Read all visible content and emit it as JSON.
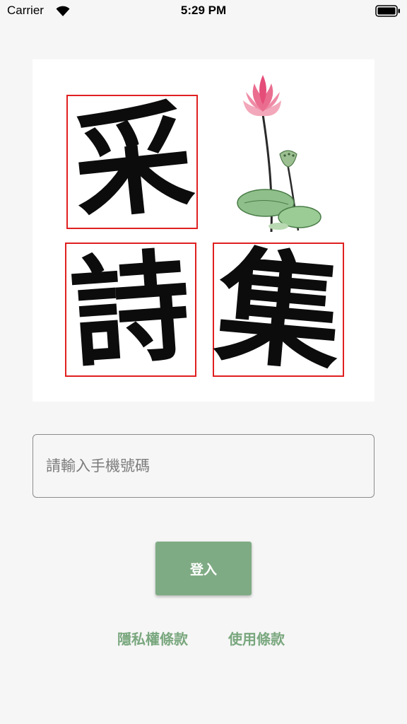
{
  "status_bar": {
    "carrier": "Carrier",
    "time": "5:29 PM",
    "icons": [
      "wifi-icon",
      "battery-icon"
    ]
  },
  "logo": {
    "characters": [
      "采",
      "詩",
      "集"
    ],
    "frame_color": "#e02020",
    "decoration": "lotus-illustration"
  },
  "phone_input": {
    "placeholder": "請輸入手機號碼",
    "value": ""
  },
  "login_button": {
    "label": "登入"
  },
  "links": {
    "privacy": "隱私權條款",
    "terms": "使用條款"
  },
  "colors": {
    "accent": "#7fab84",
    "link": "#79a77e",
    "background": "#f6f6f6"
  }
}
